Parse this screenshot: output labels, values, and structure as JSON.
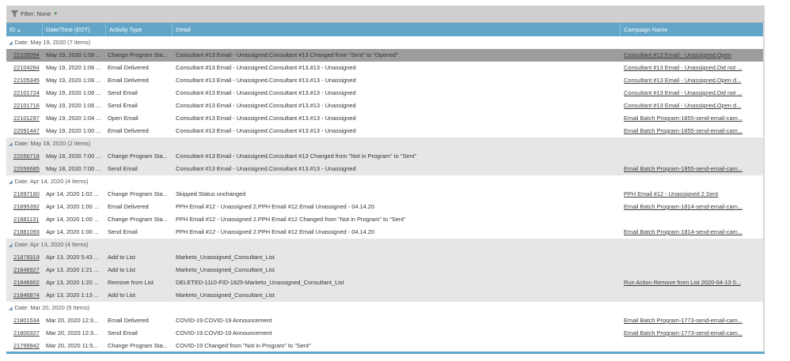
{
  "filter": {
    "label": "Filter: None"
  },
  "columns": {
    "id": "ID",
    "date": "Date/Time (EDT)",
    "type": "Activity Type",
    "detail": "Detail",
    "campaign": "Campaign Name"
  },
  "groups": [
    {
      "label": "Date: May 19, 2020 (7 Items)",
      "rows": [
        {
          "id": "22105094",
          "date": "May 19, 2020 1:08 ...",
          "type": "Change Program Sta...",
          "detail": "Consultant #13 Email - Unassigned.Consultant #13 Changed from \"Sent\" to \"Opened\"",
          "campaign": "Consultant #13 Email - Unassigned.Open"
        },
        {
          "id": "22104284",
          "date": "May 19, 2020 1:06 ...",
          "type": "Email Delivered",
          "detail": "Consultant #13 Email - Unassigned.Consultant #13.#13 - Unassigned",
          "campaign": "Consultant #13 Email - Unassigned.Did not ..."
        },
        {
          "id": "22105345",
          "date": "May 19, 2020 1:06 ...",
          "type": "Email Delivered",
          "detail": "Consultant #13 Email - Unassigned.Consultant #13.#13 - Unassigned",
          "campaign": "Consultant #13 Email - Unassigned.Open d..."
        },
        {
          "id": "22101724",
          "date": "May 19, 2020 1:06 ...",
          "type": "Send Email",
          "detail": "Consultant #13 Email - Unassigned.Consultant #13.#13 - Unassigned",
          "campaign": "Consultant #13 Email - Unassigned.Did not ..."
        },
        {
          "id": "22101716",
          "date": "May 19, 2020 1:06 ...",
          "type": "Send Email",
          "detail": "Consultant #13 Email - Unassigned.Consultant #13.#13 - Unassigned",
          "campaign": "Consultant #13 Email - Unassigned.Open d..."
        },
        {
          "id": "22101297",
          "date": "May 19, 2020 1:04 ...",
          "type": "Open Email",
          "detail": "Consultant #13 Email - Unassigned.Consultant #13.#13 - Unassigned",
          "campaign": "Email Batch Program-1855-send-email-cam..."
        },
        {
          "id": "22091447",
          "date": "May 19, 2020 1:00 ...",
          "type": "Email Delivered",
          "detail": "Consultant #13 Email - Unassigned.Consultant #13.#13 - Unassigned",
          "campaign": "Email Batch Program-1855-send-email-cam..."
        }
      ]
    },
    {
      "label": "Date: May 18, 2020 (2 Items)",
      "rows": [
        {
          "id": "22056716",
          "date": "May 18, 2020 7:00 ...",
          "type": "Change Program Sta...",
          "detail": "Consultant #13 Email - Unassigned.Consultant #13 Changed from \"Not in Program\" to \"Sent\"",
          "campaign": ""
        },
        {
          "id": "22056685",
          "date": "May 18, 2020 7:00 ...",
          "type": "Send Email",
          "detail": "Consultant #13 Email - Unassigned.Consultant #13.#13 - Unassigned",
          "campaign": "Email Batch Program-1855-send-email-cam..."
        }
      ]
    },
    {
      "label": "Date: Apr 14, 2020 (4 Items)",
      "rows": [
        {
          "id": "21897160",
          "date": "Apr 14, 2020 1:02 ...",
          "type": "Change Program Sta...",
          "detail": "Skipped Status unchanged",
          "campaign": "PPH Email #12 - Unassigned 2.Sent"
        },
        {
          "id": "21895392",
          "date": "Apr 14, 2020 1:00 ...",
          "type": "Email Delivered",
          "detail": "PPH Email #12 - Unassigned 2.PPH Email #12.Email Unassigned - 04.14.20",
          "campaign": "Email Batch Program-1814-send-email-cam..."
        },
        {
          "id": "21881131",
          "date": "Apr 14, 2020 1:00 ...",
          "type": "Change Program Sta...",
          "detail": "PPH Email #12 - Unassigned 2.PPH Email #12 Changed from \"Not in Program\" to \"Sent\"",
          "campaign": ""
        },
        {
          "id": "21881093",
          "date": "Apr 14, 2020 1:00 ...",
          "type": "Send Email",
          "detail": "PPH Email #12 - Unassigned 2.PPH Email #12.Email Unassigned - 04.14.20",
          "campaign": "Email Batch Program-1814-send-email-cam..."
        }
      ]
    },
    {
      "label": "Date: Apr 13, 2020 (4 Items)",
      "rows": [
        {
          "id": "21879319",
          "date": "Apr 13, 2020 5:43 ...",
          "type": "Add to List",
          "detail": "Marketo_Unassigned_Consultant_List",
          "campaign": ""
        },
        {
          "id": "21846927",
          "date": "Apr 13, 2020 1:21 ...",
          "type": "Add to List",
          "detail": "Marketo_Unassigned_Consultant_List",
          "campaign": ""
        },
        {
          "id": "21846902",
          "date": "Apr 13, 2020 1:20 ...",
          "type": "Remove from List",
          "detail": "DELETED-1110-FID-1825-Marketo_Unassigned_Consultant_List",
          "campaign": "Run Action Remove from List 2020-04-13 0..."
        },
        {
          "id": "21846874",
          "date": "Apr 13, 2020 1:13 ...",
          "type": "Add to List",
          "detail": "Marketo_Unassigned_Consultant_List",
          "campaign": ""
        }
      ]
    },
    {
      "label": "Date: Mar 20, 2020 (5 Items)",
      "rows": [
        {
          "id": "21801534",
          "date": "Mar 20, 2020 12:3...",
          "type": "Email Delivered",
          "detail": "COVID-19.COVID-19 Announcement",
          "campaign": "Email Batch Program-1773-send-email-cam..."
        },
        {
          "id": "21800327",
          "date": "Mar 20, 2020 12:3...",
          "type": "Send Email",
          "detail": "COVID-19.COVID-19 Announcement",
          "campaign": "Email Batch Program-1773-send-email-cam..."
        },
        {
          "id": "21799942",
          "date": "Mar 20, 2020 11:5...",
          "type": "Change Program Sta...",
          "detail": "COVID-19 Changed from \"Not in Program\" to \"Sent\"",
          "campaign": ""
        }
      ]
    }
  ],
  "selected_row": "22105094"
}
